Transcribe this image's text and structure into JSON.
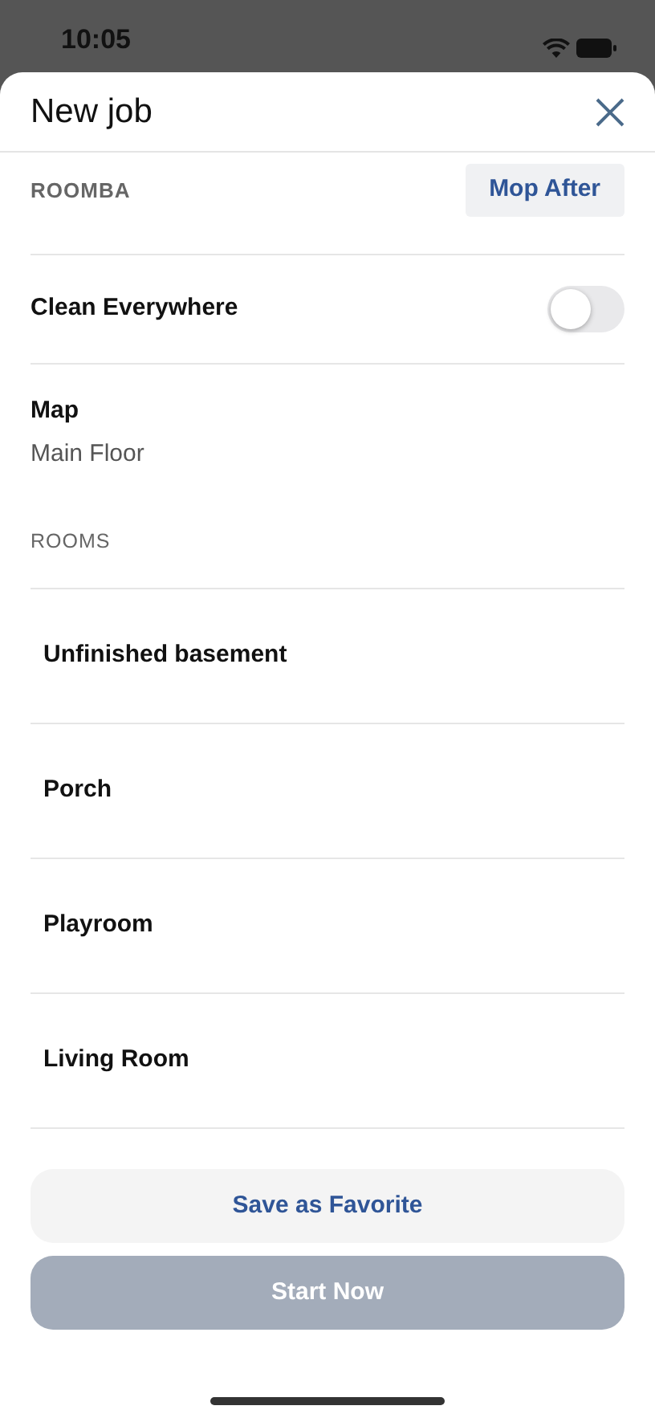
{
  "status_bar": {
    "time": "10:05"
  },
  "header": {
    "title": "New job"
  },
  "roomba": {
    "label": "ROOMBA",
    "button": "Mop After"
  },
  "clean_everywhere": {
    "label": "Clean Everywhere",
    "on": false
  },
  "map": {
    "label": "Map",
    "value": "Main Floor"
  },
  "rooms": {
    "label": "ROOMS",
    "items": [
      {
        "name": "Unfinished basement"
      },
      {
        "name": "Porch"
      },
      {
        "name": "Playroom"
      },
      {
        "name": "Living Room"
      }
    ]
  },
  "buttons": [
    {
      "label": "Save as Favorite",
      "disabled": false
    },
    {
      "label": "Start Now",
      "disabled": true
    }
  ]
}
